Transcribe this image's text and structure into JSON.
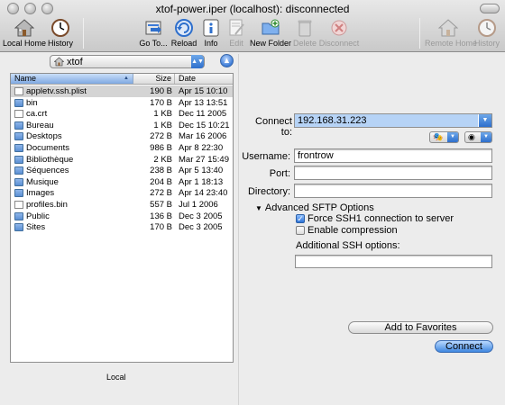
{
  "window": {
    "title": "xtof-power.iper (localhost): disconnected"
  },
  "toolbar": {
    "local_home": "Local Home",
    "history": "History",
    "goto": "Go To...",
    "reload": "Reload",
    "info": "Info",
    "edit": "Edit",
    "new_folder": "New Folder",
    "delete": "Delete",
    "disconnect": "Disconnect",
    "remote_home": "Remote Home",
    "history_right": "History"
  },
  "local": {
    "path": "xtof",
    "columns": {
      "name": "Name",
      "size": "Size",
      "date": "Date"
    },
    "files": [
      {
        "name": "appletv.ssh.plist",
        "size": "190 B",
        "date": "Apr 15 10:10",
        "type": "doc"
      },
      {
        "name": "bin",
        "size": "170 B",
        "date": "Apr 13 13:51",
        "type": "folder"
      },
      {
        "name": "ca.crt",
        "size": "1 KB",
        "date": "Dec 11 2005",
        "type": "doc"
      },
      {
        "name": "Bureau",
        "size": "1 KB",
        "date": "Dec 15 10:21",
        "type": "folder"
      },
      {
        "name": "Desktops",
        "size": "272 B",
        "date": "Mar 16 2006",
        "type": "folder"
      },
      {
        "name": "Documents",
        "size": "986 B",
        "date": "Apr 8 22:30",
        "type": "folder"
      },
      {
        "name": "Bibliothèque",
        "size": "2 KB",
        "date": "Mar 27 15:49",
        "type": "folder"
      },
      {
        "name": "Séquences",
        "size": "238 B",
        "date": "Apr 5 13:40",
        "type": "folder"
      },
      {
        "name": "Musique",
        "size": "204 B",
        "date": "Apr 1 18:13",
        "type": "folder"
      },
      {
        "name": "Images",
        "size": "272 B",
        "date": "Apr 14 23:40",
        "type": "folder"
      },
      {
        "name": "profiles.bin",
        "size": "557 B",
        "date": "Jul 1 2006",
        "type": "doc"
      },
      {
        "name": "Public",
        "size": "136 B",
        "date": "Dec 3 2005",
        "type": "folder"
      },
      {
        "name": "Sites",
        "size": "170 B",
        "date": "Dec 3 2005",
        "type": "folder"
      }
    ],
    "label": "Local"
  },
  "connect": {
    "connect_to_label": "Connect to:",
    "connect_to_value": "192.168.31.223",
    "username_label": "Username:",
    "username_value": "frontrow",
    "port_label": "Port:",
    "port_value": "",
    "directory_label": "Directory:",
    "directory_value": "",
    "advanced_label": "Advanced SFTP Options",
    "force_ssh1_label": "Force SSH1 connection to server",
    "force_ssh1_checked": true,
    "compression_label": "Enable compression",
    "compression_checked": false,
    "additional_ssh_label": "Additional SSH options:",
    "additional_ssh_value": "",
    "add_favorites": "Add to Favorites",
    "connect_button": "Connect"
  },
  "colors": {
    "selection": "#b6d3f6",
    "accent": "#3f87e0",
    "row_selected": "#d4d4d4"
  }
}
